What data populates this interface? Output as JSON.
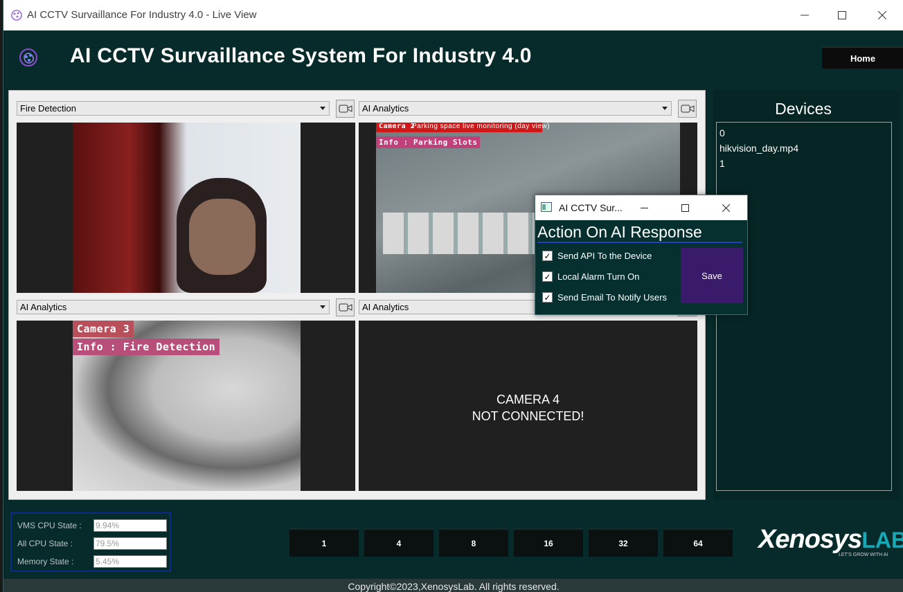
{
  "window": {
    "title": "AI CCTV Survaillance For Industry 4.0 - Live View"
  },
  "header": {
    "title": "AI CCTV Survaillance System For Industry 4.0",
    "home_label": "Home"
  },
  "cameras": [
    {
      "dropdown": "Fire Detection"
    },
    {
      "dropdown": "AI Analytics",
      "overlay_camera": "Camera 2",
      "overlay_title": "Parking space live monitoring (day view)",
      "overlay_info": "Info : Parking Slots"
    },
    {
      "dropdown": "AI Analytics",
      "overlay_camera": "Camera 3",
      "overlay_info": "Info : Fire Detection"
    },
    {
      "dropdown": "AI Analytics",
      "status_line1": "CAMERA 4",
      "status_line2": "NOT CONNECTED!"
    }
  ],
  "devices": {
    "title": "Devices",
    "items": [
      "0",
      "hikvision_day.mp4",
      "1"
    ]
  },
  "stats": {
    "vms_cpu_label": "VMS CPU State :",
    "vms_cpu_value": "9.94%",
    "all_cpu_label": "All CPU State   :",
    "all_cpu_value": "79.5%",
    "memory_label": "Memory State  :",
    "memory_value": "5.45%"
  },
  "grid_buttons": [
    "1",
    "4",
    "8",
    "16",
    "32",
    "64"
  ],
  "brand": {
    "name_part1": "Xenosys",
    "name_part2": "LAB",
    "tagline": "LET'S GROW WITH AI"
  },
  "footer": "Copyright©2023,XenosysLab. All rights reserved.",
  "dialog": {
    "title": "AI CCTV Sur...",
    "heading": "Action On AI Response",
    "options": [
      "Send API To the Device",
      "Local Alarm Turn On",
      "Send Email To Notify Users"
    ],
    "checked": [
      true,
      true,
      true
    ],
    "save_label": "Save"
  },
  "colors": {
    "window_bg": "#072a2a",
    "save_button": "#3a1a6a",
    "stats_border": "#0b2a8a",
    "brand_accent": "#17a8b5"
  }
}
